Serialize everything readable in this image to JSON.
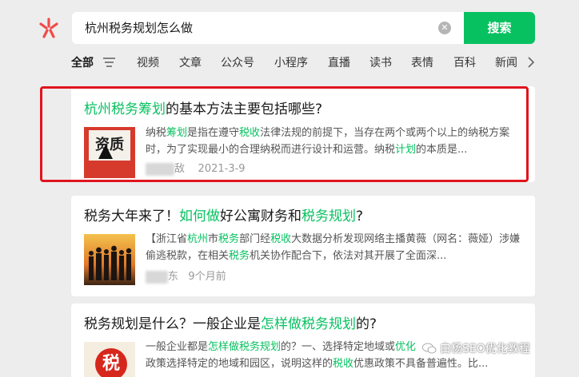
{
  "search": {
    "query": "杭州税务规划怎么做",
    "button_label": "搜索"
  },
  "tabs": [
    {
      "label": "全部",
      "active": true
    },
    {
      "label": "视频"
    },
    {
      "label": "文章"
    },
    {
      "label": "公众号"
    },
    {
      "label": "小程序"
    },
    {
      "label": "直播"
    },
    {
      "label": "读书"
    },
    {
      "label": "表情"
    },
    {
      "label": "百科"
    },
    {
      "label": "新闻"
    }
  ],
  "results": [
    {
      "title": [
        {
          "t": "杭州税务筹划",
          "hl": true
        },
        {
          "t": "的基本方法主要包括哪些?",
          "hl": false
        }
      ],
      "snippet": [
        {
          "t": "纳税",
          "hl": false
        },
        {
          "t": "筹划",
          "hl": true
        },
        {
          "t": "是指在遵守",
          "hl": false
        },
        {
          "t": "税收",
          "hl": true
        },
        {
          "t": "法律法规的前提下，当存在两个或两个以上的纳税方案时，为了实现最小的合理纳税而进行设计和运营。纳税",
          "hl": false
        },
        {
          "t": "计划",
          "hl": true
        },
        {
          "t": "的本质是...",
          "hl": false
        }
      ],
      "thumb_text": "资质",
      "meta_tail": "敌",
      "date": "2021-3-9"
    },
    {
      "title": [
        {
          "t": "税务大年来了！",
          "hl": false
        },
        {
          "t": "如何做",
          "hl": true
        },
        {
          "t": "好公寓财务和",
          "hl": false
        },
        {
          "t": "税务规划",
          "hl": true
        },
        {
          "t": "?",
          "hl": false
        }
      ],
      "snippet": [
        {
          "t": "【浙江省",
          "hl": false
        },
        {
          "t": "杭州",
          "hl": true
        },
        {
          "t": "市",
          "hl": false
        },
        {
          "t": "税务",
          "hl": true
        },
        {
          "t": "部门经",
          "hl": false
        },
        {
          "t": "税收",
          "hl": true
        },
        {
          "t": "大数据分析发现网络主播黄薇（网名：薇娅）涉嫌偷逃税款，在相关",
          "hl": false
        },
        {
          "t": "税务",
          "hl": true
        },
        {
          "t": "机关协作配合下，依法对其开展了全面深...",
          "hl": false
        }
      ],
      "meta_tail": "东",
      "date": "9个月前"
    },
    {
      "title": [
        {
          "t": "税务规划是什么？一般企业是",
          "hl": false
        },
        {
          "t": "怎样做税务规划",
          "hl": true
        },
        {
          "t": "的?",
          "hl": false
        }
      ],
      "snippet": [
        {
          "t": "一般企业都是",
          "hl": false
        },
        {
          "t": "怎样做税务规划",
          "hl": true
        },
        {
          "t": "的？一、选择特定地域或",
          "hl": false
        },
        {
          "t": "优化",
          "hl": true
        },
        {
          "t": "\n政策选择特定的地域和园区，说明这样的",
          "hl": false
        },
        {
          "t": "税收",
          "hl": true
        },
        {
          "t": "优惠政策不具备普遍性。比...",
          "hl": false
        }
      ],
      "thumb_text": "税"
    }
  ],
  "watermark": "白杨SEO优化教程",
  "colors": {
    "accent": "#07c160",
    "highlight_frame": "#e0141d"
  }
}
